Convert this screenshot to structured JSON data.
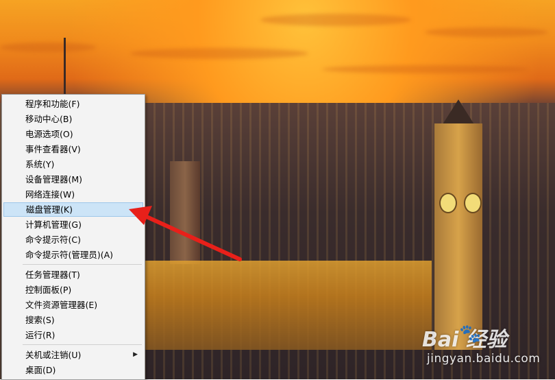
{
  "context_menu": {
    "items": [
      {
        "label": "程序和功能(F)"
      },
      {
        "label": "移动中心(B)"
      },
      {
        "label": "电源选项(O)"
      },
      {
        "label": "事件查看器(V)"
      },
      {
        "label": "系统(Y)"
      },
      {
        "label": "设备管理器(M)"
      },
      {
        "label": "网络连接(W)"
      },
      {
        "label": "磁盘管理(K)"
      },
      {
        "label": "计算机管理(G)"
      },
      {
        "label": "命令提示符(C)"
      },
      {
        "label": "命令提示符(管理员)(A)"
      },
      {
        "label": "任务管理器(T)"
      },
      {
        "label": "控制面板(P)"
      },
      {
        "label": "文件资源管理器(E)"
      },
      {
        "label": "搜索(S)"
      },
      {
        "label": "运行(R)"
      },
      {
        "label": "关机或注销(U)"
      },
      {
        "label": "桌面(D)"
      }
    ],
    "highlighted_item": "磁盘管理(K)"
  },
  "watermark": {
    "logo": "Bai  经验",
    "paw_icon": "paw-icon",
    "url": "jingyan.baidu.com"
  },
  "annotation": {
    "arrow_color": "#e8201a"
  },
  "colors": {
    "menu_bg": "#f3f3f3",
    "highlight_bg": "#cce4f7",
    "highlight_border": "#9cc6ea"
  }
}
